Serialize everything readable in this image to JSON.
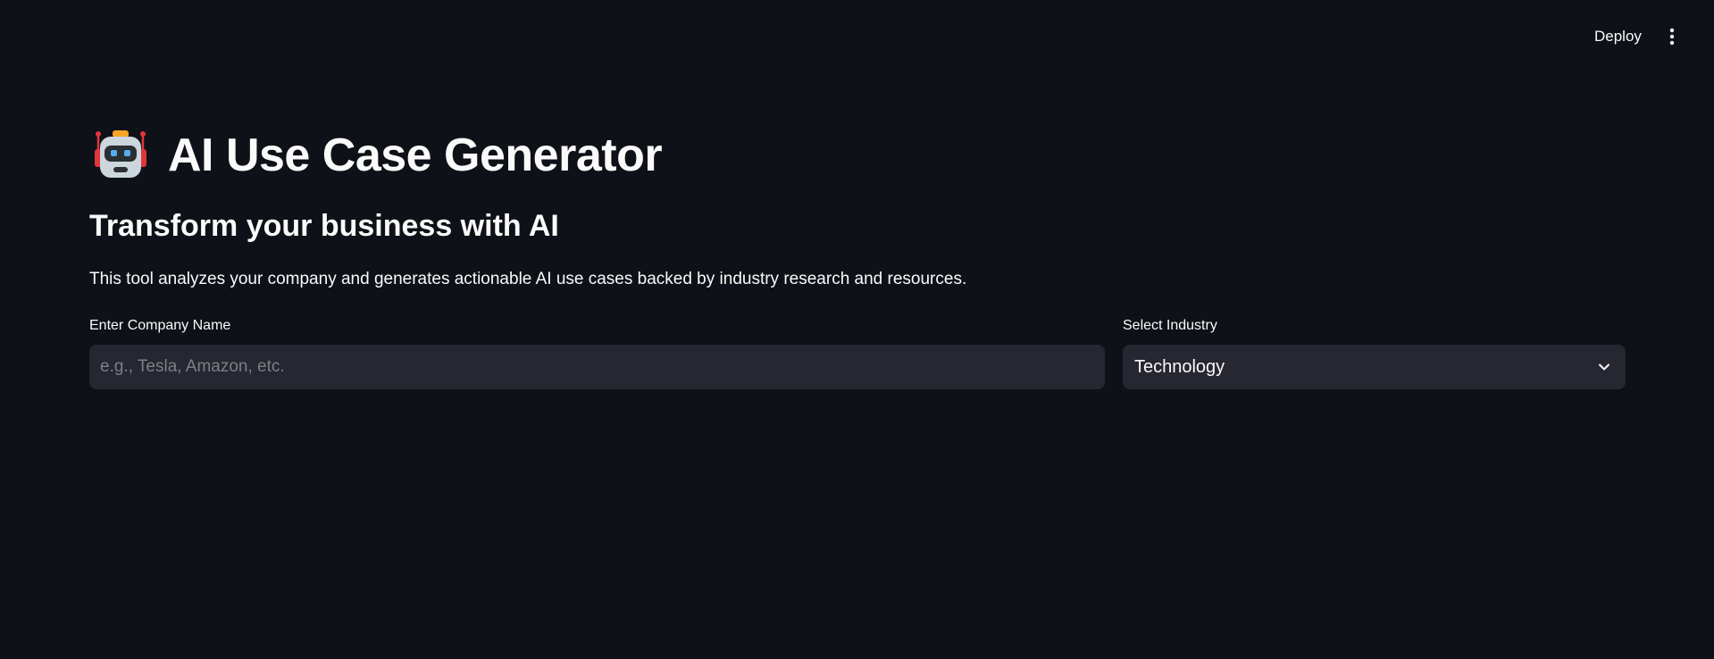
{
  "header": {
    "deploy_label": "Deploy",
    "menu_icon": "vertical-dots-icon"
  },
  "main": {
    "title_icon": "robot-icon",
    "title": "AI Use Case Generator",
    "subtitle": "Transform your business with AI",
    "description": "This tool analyzes your company and generates actionable AI use cases backed by industry research and resources.",
    "company_field": {
      "label": "Enter Company Name",
      "value": "",
      "placeholder": "e.g., Tesla, Amazon, etc."
    },
    "industry_field": {
      "label": "Select Industry",
      "selected": "Technology"
    }
  },
  "colors": {
    "background": "#0e1117",
    "input_background": "#262730",
    "text": "#fafafa",
    "placeholder": "#7d7f86"
  }
}
